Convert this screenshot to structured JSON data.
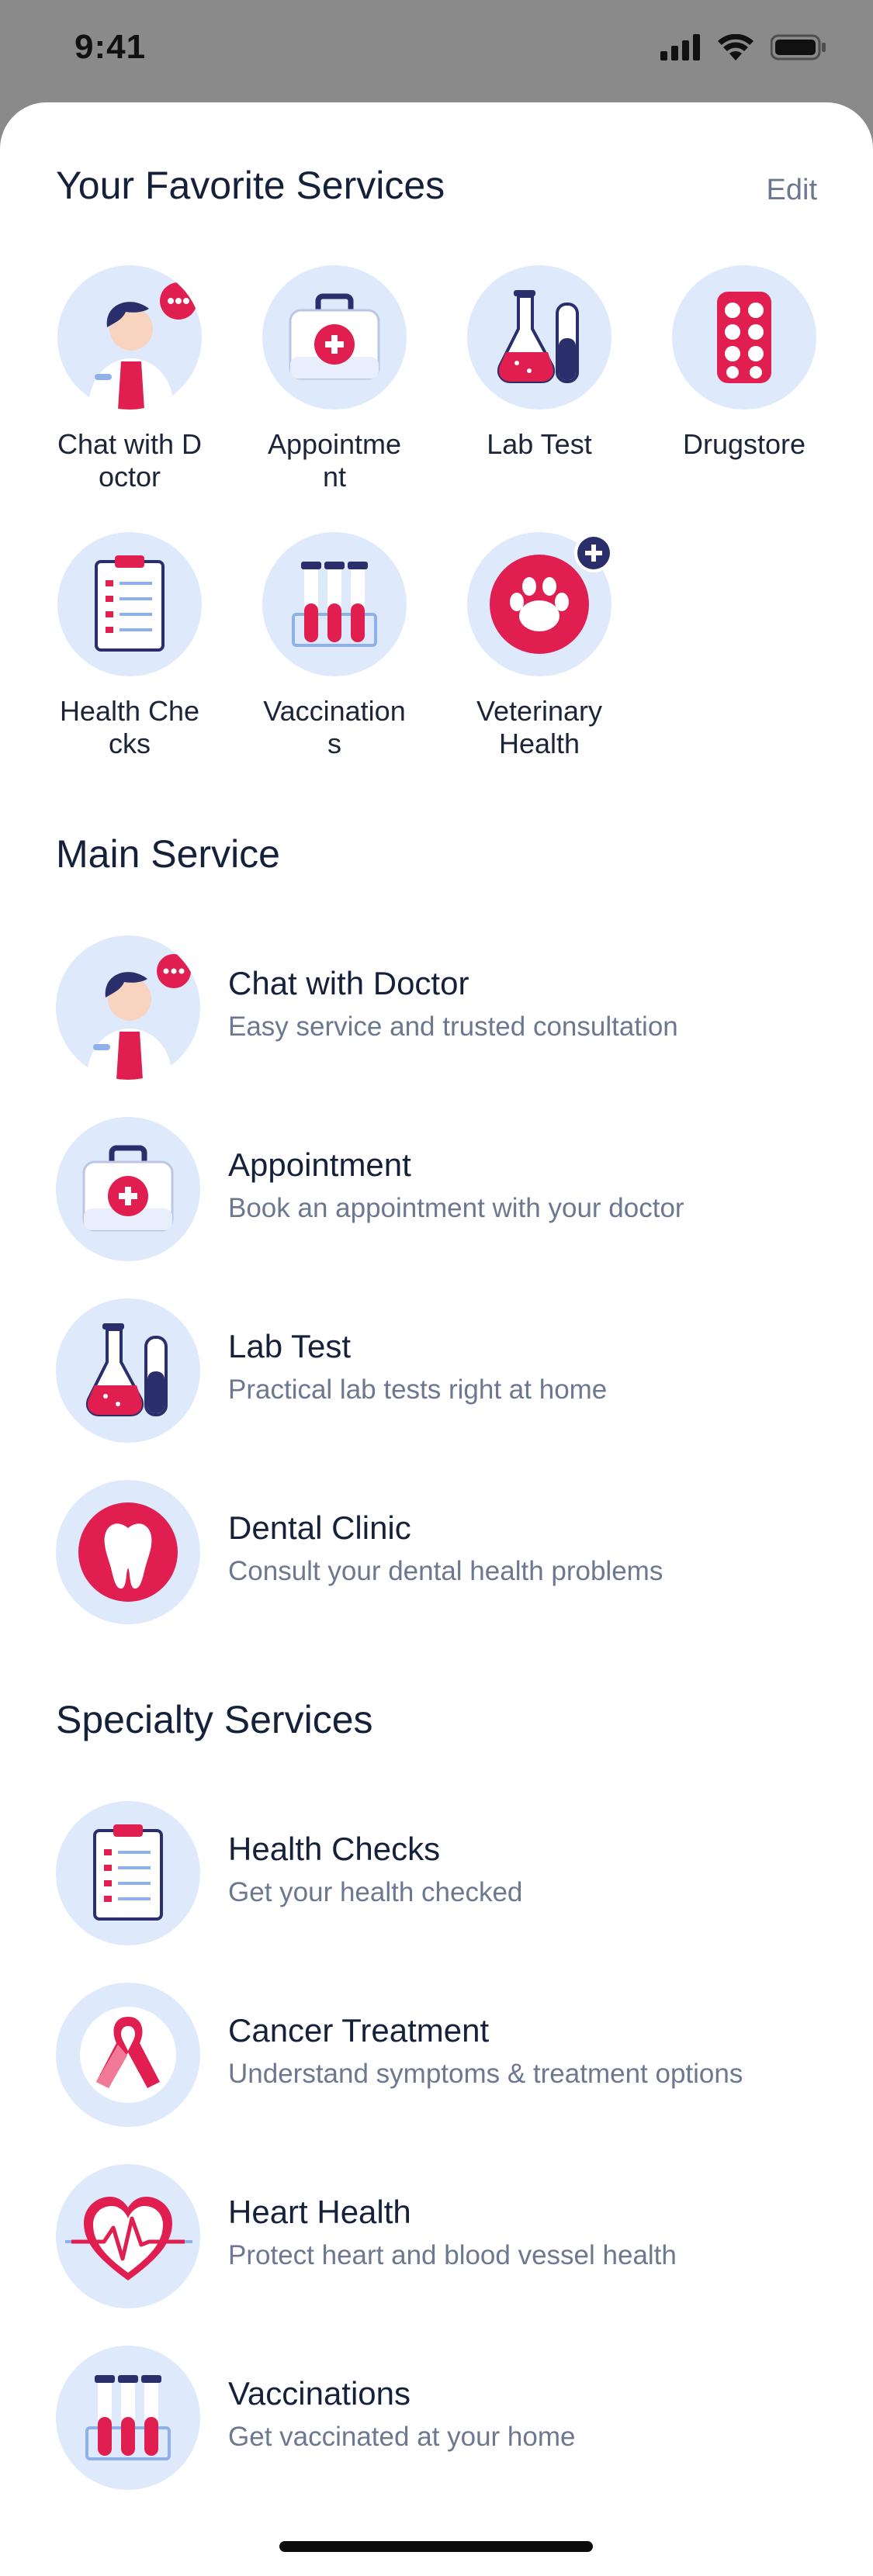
{
  "status_bar": {
    "time": "9:41"
  },
  "favorites": {
    "title": "Your Favorite Services",
    "edit_label": "Edit",
    "items": [
      {
        "label": "Chat with Doctor",
        "icon": "doctor-icon"
      },
      {
        "label": "Appointment",
        "icon": "medical-kit-icon"
      },
      {
        "label": "Lab Test",
        "icon": "lab-flask-icon"
      },
      {
        "label": "Drugstore",
        "icon": "pill-pack-icon"
      },
      {
        "label": "Health Checks",
        "icon": "clipboard-icon"
      },
      {
        "label": "Vaccinations",
        "icon": "test-tubes-icon"
      },
      {
        "label": "Veterinary Health",
        "icon": "paw-icon"
      }
    ]
  },
  "main_service": {
    "title": "Main Service",
    "items": [
      {
        "title": "Chat with Doctor",
        "subtitle": "Easy service and trusted consultation",
        "icon": "doctor-icon"
      },
      {
        "title": "Appointment",
        "subtitle": "Book an appointment with your doctor",
        "icon": "medical-kit-icon"
      },
      {
        "title": "Lab Test",
        "subtitle": "Practical lab tests right at home",
        "icon": "lab-flask-icon"
      },
      {
        "title": "Dental Clinic",
        "subtitle": "Consult your dental health problems",
        "icon": "tooth-icon"
      }
    ]
  },
  "specialty_services": {
    "title": "Specialty Services",
    "items": [
      {
        "title": "Health Checks",
        "subtitle": "Get your health checked",
        "icon": "clipboard-icon"
      },
      {
        "title": "Cancer Treatment",
        "subtitle": "Understand symptoms & treatment options",
        "icon": "ribbon-icon"
      },
      {
        "title": "Heart Health",
        "subtitle": "Protect heart and blood vessel health",
        "icon": "heart-icon"
      },
      {
        "title": "Vaccinations",
        "subtitle": "Get vaccinated at your home",
        "icon": "test-tubes-icon"
      }
    ]
  },
  "colors": {
    "accent": "#e01e4f",
    "navy": "#2a2f6b",
    "icon_bg": "#dfe9fc",
    "subtitle": "#6b7890"
  }
}
